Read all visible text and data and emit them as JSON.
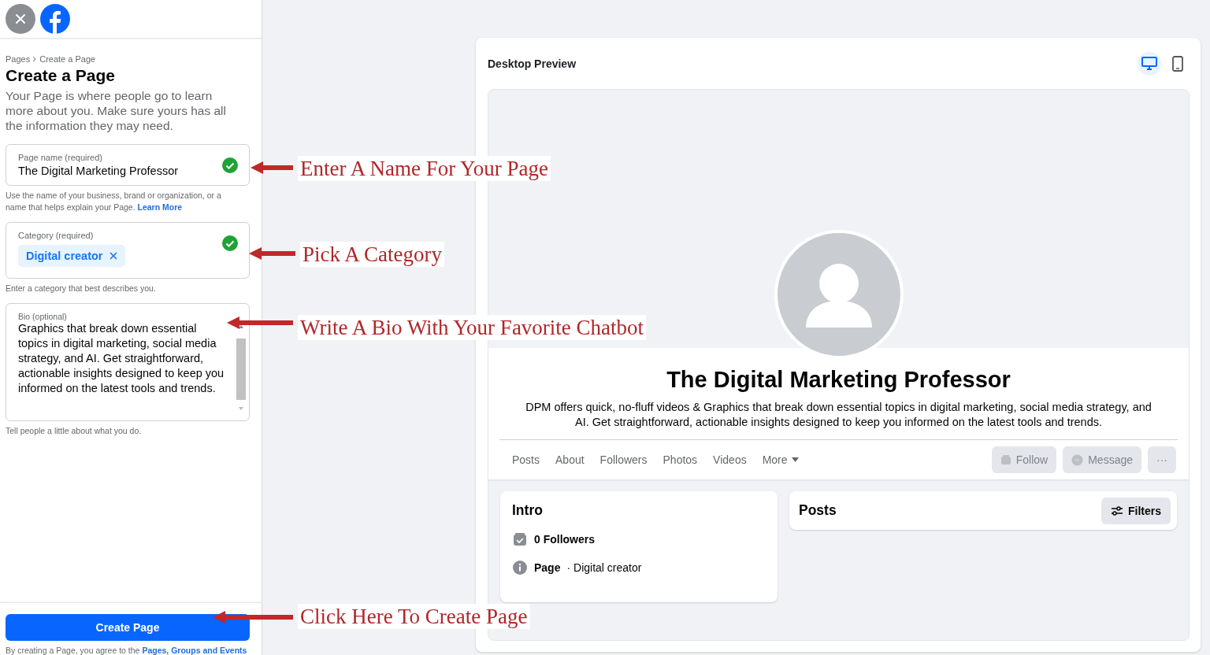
{
  "form": {
    "breadcrumb": [
      {
        "label": "Pages"
      },
      {
        "label": "Create a Page"
      }
    ],
    "title": "Create a Page",
    "intro": "Your Page is where people go to learn more about you. Make sure yours has all the information they may need.",
    "name_field": {
      "label": "Page name (required)",
      "value": "The Digital Marketing Professor",
      "valid": true
    },
    "name_help": "Use the name of your business, brand or organization, or a name that helps explain your Page.",
    "name_help_link": "Learn More",
    "category_field": {
      "label": "Category (required)",
      "chip": "Digital creator",
      "valid": true
    },
    "category_help": "Enter a category that best describes you.",
    "bio_field": {
      "label": "Bio (optional)",
      "value": "Graphics that break down essential topics in digital marketing, social media strategy, and AI. Get straightforward, actionable insights designed to keep you informed on the latest tools and trends."
    },
    "bio_help": "Tell people a little about what you do.",
    "submit": "Create Page",
    "terms": "By creating a Page, you agree to the",
    "terms_link": "Pages, Groups and Events"
  },
  "preview": {
    "title": "Desktop Preview",
    "views": [
      {
        "kind": "desktop",
        "selected": true
      },
      {
        "kind": "mobile",
        "selected": false
      }
    ],
    "page_name": "The Digital Marketing Professor",
    "description": "DPM offers quick, no-fluff videos & Graphics that break down essential topics in digital marketing, social media strategy, and AI. Get straightforward, actionable insights designed to keep you informed on the latest tools and trends.",
    "tabs": [
      {
        "label": "Posts"
      },
      {
        "label": "About"
      },
      {
        "label": "Followers"
      },
      {
        "label": "Photos"
      },
      {
        "label": "Videos"
      },
      {
        "label": "More",
        "dropdown": true
      }
    ],
    "actions": [
      {
        "kind": "follow",
        "label": "Follow"
      },
      {
        "kind": "message",
        "label": "Message"
      },
      {
        "kind": "more",
        "label": "···"
      }
    ],
    "intro": {
      "title": "Intro",
      "followers": "0 Followers",
      "page_label": "Page",
      "page_category": "· Digital creator"
    },
    "posts": {
      "title": "Posts",
      "filter": "Filters"
    }
  },
  "annotations": [
    {
      "text": "Enter A Name For Your Page"
    },
    {
      "text": "Pick A Category"
    },
    {
      "text": "Write A Bio With Your Favorite Chatbot"
    },
    {
      "text": "Click Here To Create Page"
    }
  ]
}
